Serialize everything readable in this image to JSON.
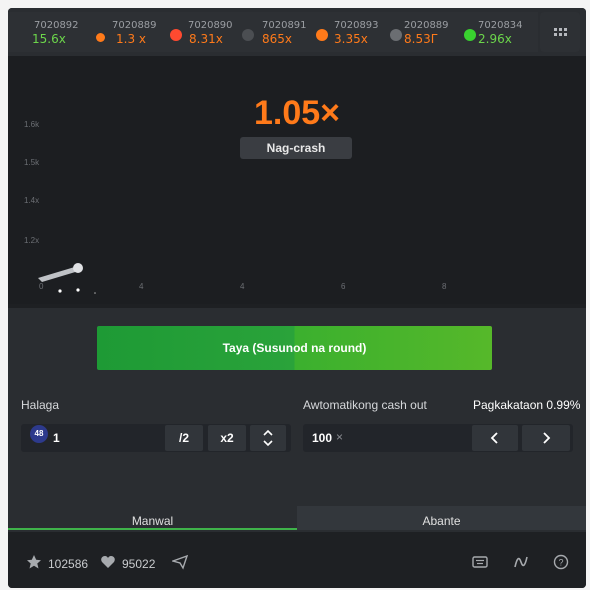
{
  "history": [
    {
      "round": "7020892",
      "mult": "15.6x",
      "color": "#6cd64b",
      "dot": "none"
    },
    {
      "round": "7020889",
      "mult": "1.3 x",
      "color": "#ff7a1a",
      "dot": "#ff7a1a"
    },
    {
      "round": "7020890",
      "mult": "8.31x",
      "color": "#ff7a1a",
      "dot": "#ff4a30"
    },
    {
      "round": "7020891",
      "mult": "865x",
      "color": "#ff7a1a",
      "dot": "#4b4e52"
    },
    {
      "round": "7020893",
      "mult": "3.35x",
      "color": "#ff7a1a",
      "dot": "#ff7a1a"
    },
    {
      "round": "2020889",
      "mult": "8.53Г",
      "color": "#ff7a1a",
      "dot": "#6b6e72"
    },
    {
      "round": "7020834",
      "mult": "2.96x",
      "color": "#6cd64b",
      "dot": "#39d12f"
    }
  ],
  "round_result": {
    "multiplier": "1.05×",
    "status": "Nag-crash"
  },
  "chart": {
    "y_ticks": [
      "1.6k",
      "1.5k",
      "1.4x",
      "1.2x"
    ],
    "x_ticks": [
      "0",
      "4",
      "4",
      "6",
      "8"
    ]
  },
  "bet": {
    "button_label": "Taya (Susunod na round)",
    "amount_label": "Halaga",
    "currency_chip": "48",
    "amount_value": "1",
    "half_label": "/2",
    "double_label": "x2",
    "auto_cashout_label": "Awtomatikong cash out",
    "probability_label": "Pagkakataon 0.99%",
    "cashout_value": "100",
    "clear_symbol": "×"
  },
  "tabs": [
    {
      "label": "Manwal",
      "active": true
    },
    {
      "label": "Abante",
      "active": false
    }
  ],
  "footer": {
    "players": "102586",
    "likes": "95022"
  },
  "icons": [
    "grid-icon",
    "star-icon",
    "heart-icon",
    "send-icon",
    "keyboard-icon",
    "chart-icon",
    "help-icon",
    "chevron-up-icon",
    "chevron-down-icon",
    "chevron-left-icon",
    "chevron-right-icon"
  ]
}
